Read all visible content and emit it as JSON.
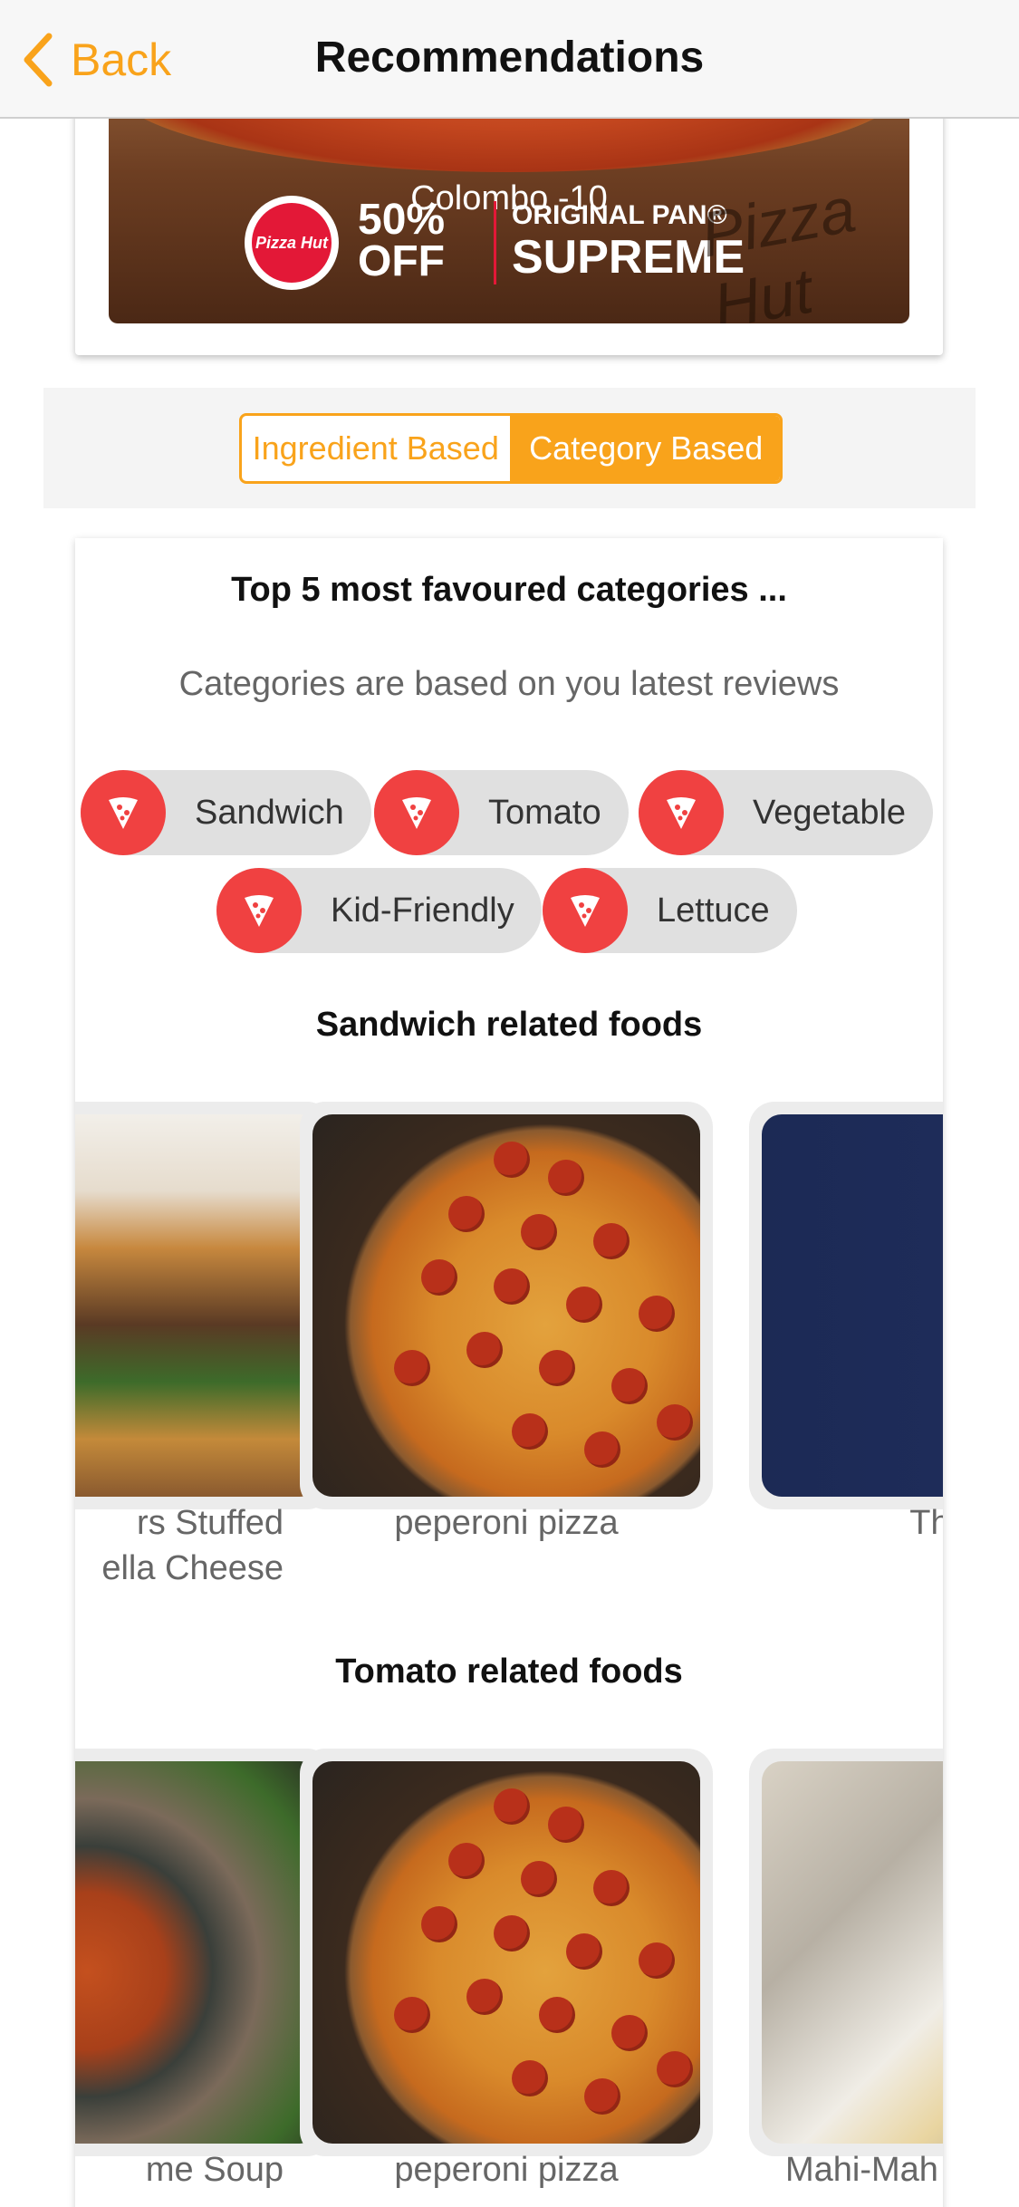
{
  "nav": {
    "back_label": "Back",
    "title": "Recommendations"
  },
  "promo": {
    "city": "Colombo -10",
    "logo_text": "Pizza Hut",
    "discount_percent": "50%",
    "discount_off": "OFF",
    "product_line1": "ORIGINAL PAN®",
    "product_line2": "SUPREME",
    "watermark": "Pizza Hut"
  },
  "tabs": [
    {
      "label": "Ingredient Based",
      "active": false
    },
    {
      "label": "Category Based",
      "active": true
    }
  ],
  "categories_section": {
    "heading": "Top 5 most favoured categories ...",
    "subtext": "Categories are based on you latest reviews",
    "chips": [
      {
        "label": "Sandwich",
        "icon": "pizza-slice-icon"
      },
      {
        "label": "Tomato",
        "icon": "pizza-slice-icon"
      },
      {
        "label": "Vegetable",
        "icon": "pizza-slice-icon"
      },
      {
        "label": "Kid-Friendly",
        "icon": "pizza-slice-icon"
      },
      {
        "label": "Lettuce",
        "icon": "pizza-slice-icon"
      }
    ]
  },
  "sections": [
    {
      "heading": "Sandwich related foods",
      "items": [
        {
          "name": "rs Stuffed\nella Cheese"
        },
        {
          "name": "peperoni pizza"
        },
        {
          "name": "The B"
        }
      ]
    },
    {
      "heading": "Tomato related foods",
      "items": [
        {
          "name": "me Soup"
        },
        {
          "name": "peperoni pizza"
        },
        {
          "name": "Mahi-Mah"
        }
      ]
    }
  ],
  "colors": {
    "accent": "#f9a31b",
    "chip_icon": "#f04141",
    "chip_bg": "#e0e0e0"
  }
}
